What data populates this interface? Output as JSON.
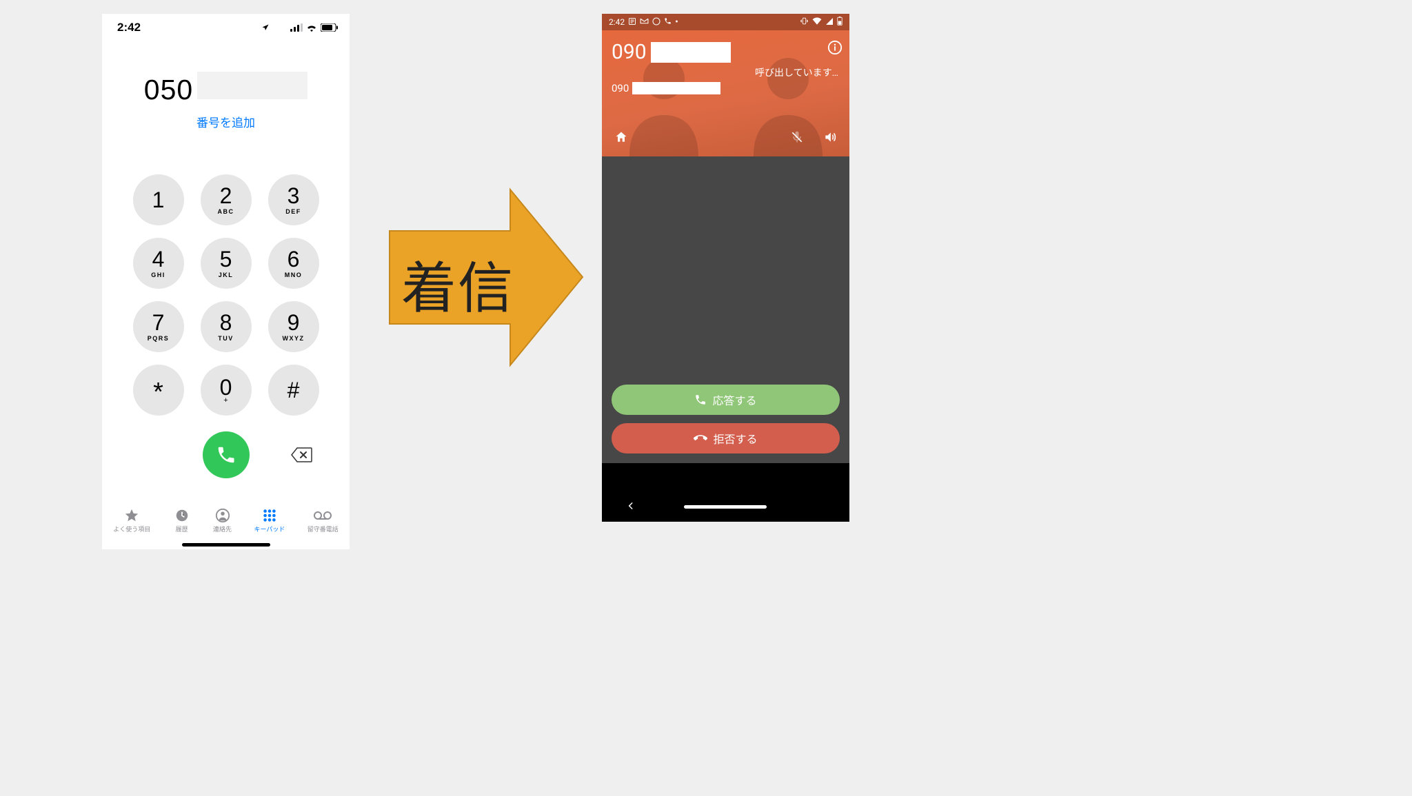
{
  "iphone": {
    "status": {
      "time": "2:42"
    },
    "dial": {
      "number": "050",
      "add_link": "番号を追加"
    },
    "keypad": [
      {
        "digit": "1",
        "letters": ""
      },
      {
        "digit": "2",
        "letters": "ABC"
      },
      {
        "digit": "3",
        "letters": "DEF"
      },
      {
        "digit": "4",
        "letters": "GHI"
      },
      {
        "digit": "5",
        "letters": "JKL"
      },
      {
        "digit": "6",
        "letters": "MNO"
      },
      {
        "digit": "7",
        "letters": "PQRS"
      },
      {
        "digit": "8",
        "letters": "TUV"
      },
      {
        "digit": "9",
        "letters": "WXYZ"
      },
      {
        "digit": "*",
        "letters": ""
      },
      {
        "digit": "0",
        "letters": "+"
      },
      {
        "digit": "#",
        "letters": ""
      }
    ],
    "tabs": {
      "favorites": "よく使う項目",
      "recents": "履歴",
      "contacts": "連絡先",
      "keypad": "キーパッド",
      "voicemail": "留守番電話"
    }
  },
  "arrow": {
    "label": "着信"
  },
  "android": {
    "status": {
      "time": "2:42"
    },
    "caller": {
      "prefix_large": "090",
      "status_text": "呼び出しています…",
      "prefix_small": "090"
    },
    "buttons": {
      "answer": "応答する",
      "decline": "拒否する"
    }
  }
}
